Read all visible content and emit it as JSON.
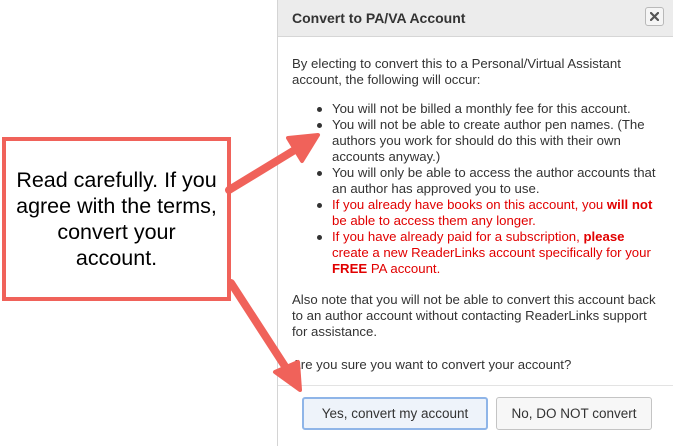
{
  "dialog": {
    "title": "Convert to PA/VA Account",
    "close_icon": "close-icon",
    "intro": "By electing to convert this to a Personal/Virtual Assistant account, the following will occur:",
    "bullets": [
      {
        "text": "You will not be billed a monthly fee for this account.",
        "style": "normal"
      },
      {
        "text": "You will not be able to create author pen names. (The authors you work for should do this with their own accounts anyway.)",
        "style": "normal"
      },
      {
        "text": "You will only be able to access the author accounts that an author has approved you to use.",
        "style": "normal"
      },
      {
        "parts": [
          "If you already have books on this account, you ",
          "will not",
          " be able to access them any longer."
        ],
        "style": "red"
      },
      {
        "parts": [
          "If you have already paid for a subscription, ",
          "please",
          " create a new ReaderLinks account specifically for your ",
          "FREE",
          " PA account."
        ],
        "style": "red"
      }
    ],
    "also_note": "Also note that you will not be able to convert this account back to an author account without contacting ReaderLinks support for assistance.",
    "question": "Are you sure you want to convert your account?",
    "buttons": {
      "yes": "Yes, convert my account",
      "no": "No, DO NOT convert"
    }
  },
  "callout": {
    "text": "Read carefully. If you agree with the terms, convert your account.",
    "border_color": "#f0625a",
    "arrow_color": "#f0625a"
  },
  "colors": {
    "warning_text": "#e10000",
    "titlebar_bg": "#ececec",
    "primary_button_border": "#8fb5e8"
  }
}
